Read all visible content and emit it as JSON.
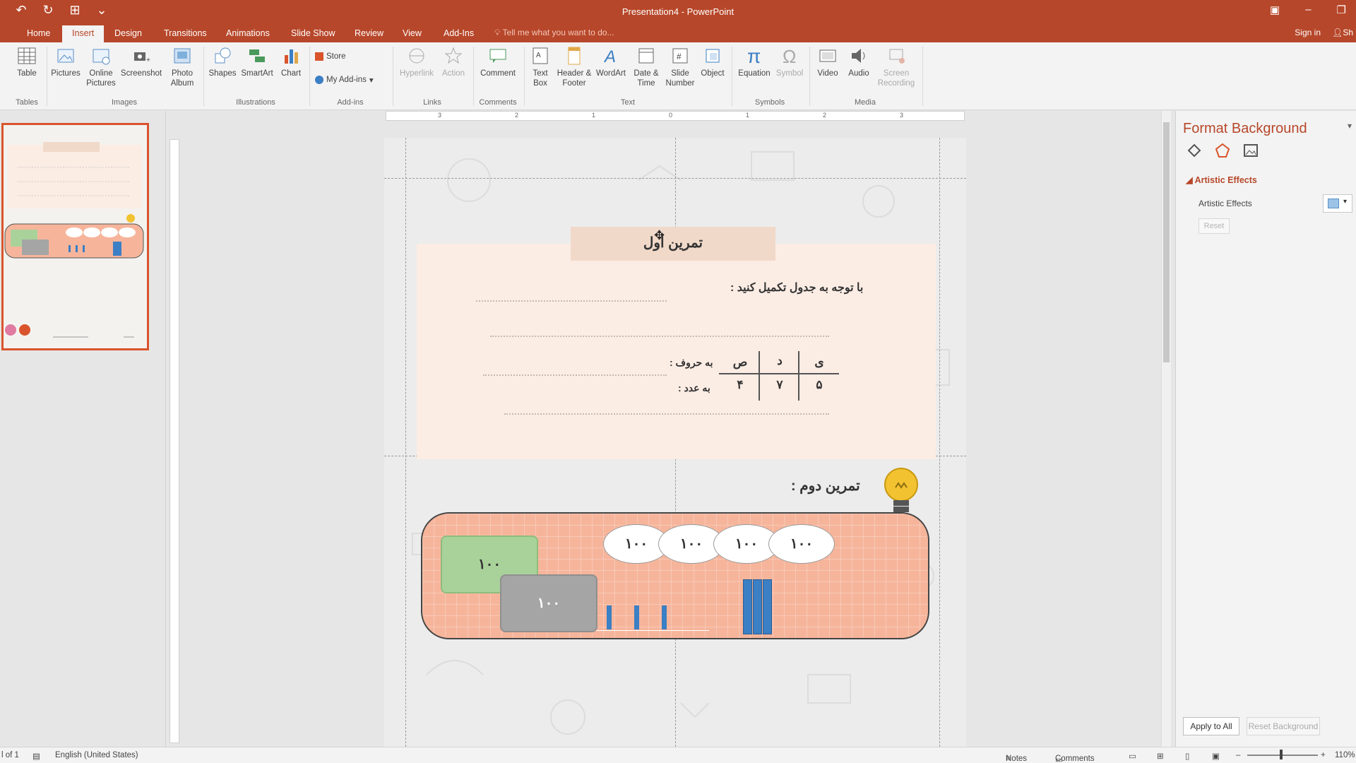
{
  "window": {
    "title": "Presentation4 - PowerPoint"
  },
  "tabs": [
    "Home",
    "Insert",
    "Design",
    "Transitions",
    "Animations",
    "Slide Show",
    "Review",
    "View",
    "Add-Ins"
  ],
  "active_tab": "Insert",
  "tell_me": "Tell me what you want to do...",
  "sign_in": "Sign in",
  "share": "Sh",
  "ribbon": {
    "table": "Table",
    "pictures": "Pictures",
    "online_pictures": "Online Pictures",
    "screenshot": "Screenshot",
    "photo_album": "Photo Album",
    "shapes": "Shapes",
    "smartart": "SmartArt",
    "chart": "Chart",
    "store": "Store",
    "my_addins": "My Add-ins",
    "hyperlink": "Hyperlink",
    "action": "Action",
    "comment": "Comment",
    "text_box": "Text Box",
    "header_footer": "Header & Footer",
    "wordart": "WordArt",
    "date_time": "Date & Time",
    "slide_number": "Slide Number",
    "object": "Object",
    "equation": "Equation",
    "symbol": "Symbol",
    "video": "Video",
    "audio": "Audio",
    "screen_recording": "Screen Recording",
    "groups": {
      "tables": "Tables",
      "images": "Images",
      "illustrations": "Illustrations",
      "addins": "Add-ins",
      "links": "Links",
      "comments": "Comments",
      "text": "Text",
      "symbols": "Symbols",
      "media": "Media"
    }
  },
  "ruler": {
    "marks": [
      "3",
      "2",
      "1",
      "0",
      "1",
      "2",
      "3"
    ]
  },
  "slide": {
    "ex1_title": "تمرین اول",
    "ex1_instruction": "با توجه به جدول تکمیل کنید :",
    "table_headers": [
      "ی",
      "د",
      "ص"
    ],
    "table_values": [
      "۵",
      "۷",
      "۴"
    ],
    "row_label_letters": "به حروف :",
    "row_label_numbers": "به عدد :",
    "ex2_title": "تمرین دوم :",
    "ovals": [
      "۱۰۰",
      "۱۰۰",
      "۱۰۰",
      "۱۰۰"
    ],
    "green_box": "۱۰۰",
    "grey_box": "۱۰۰"
  },
  "format_pane": {
    "title": "Format Background",
    "section": "Artistic Effects",
    "option_label": "Artistic Effects",
    "reset": "Reset",
    "apply_all": "Apply to All",
    "reset_background": "Reset Background"
  },
  "status": {
    "slide_info": "l of 1",
    "language": "English (United States)",
    "notes": "Notes",
    "comments": "Comments",
    "zoom": "110%"
  },
  "colors": {
    "accent": "#b7472a",
    "slide_accent": "#f6b59b"
  }
}
